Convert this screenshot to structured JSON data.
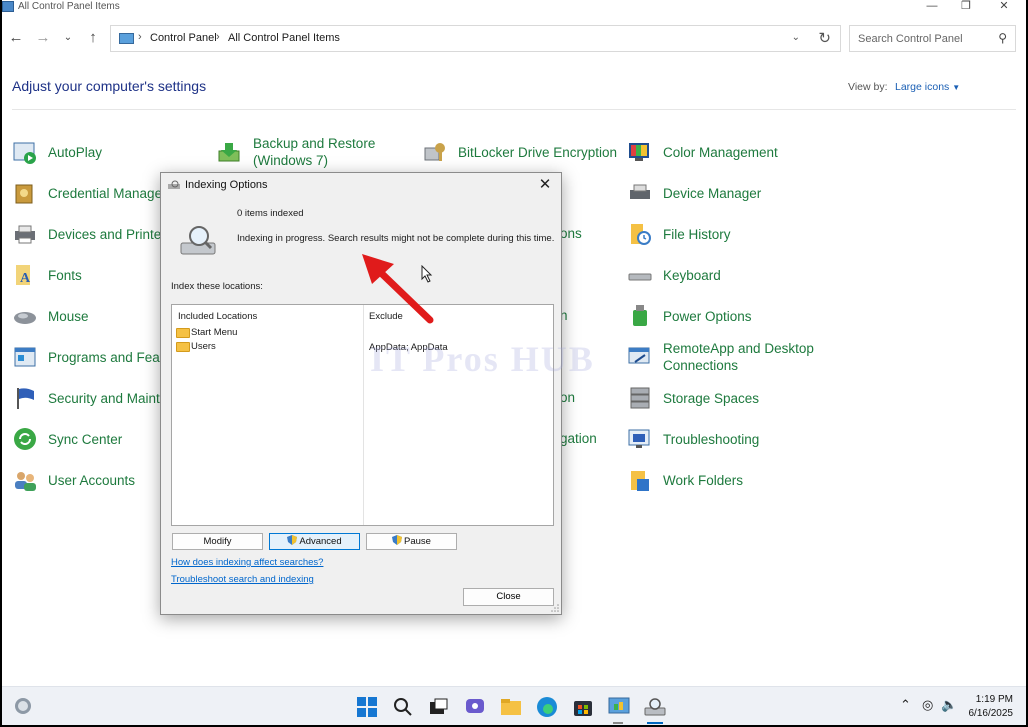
{
  "window": {
    "title": "All Control Panel Items"
  },
  "nav": {
    "breadcrumb": [
      "Control Panel",
      "All Control Panel Items"
    ],
    "search_placeholder": "Search Control Panel"
  },
  "header": {
    "title": "Adjust your computer's settings",
    "view_by_label": "View by:",
    "view_by_value": "Large icons"
  },
  "items": {
    "autoplay": "AutoPlay",
    "backup": "Backup and Restore (Windows 7)",
    "bitlocker": "BitLocker Drive Encryption",
    "color": "Color Management",
    "credential": "Credential Manager",
    "devmgr": "Device Manager",
    "devices": "Devices and Printers",
    "col3_row3_partial": "ons",
    "filehistory": "File History",
    "fonts": "Fonts",
    "keyboard": "Keyboard",
    "mouse": "Mouse",
    "col3_row5_partial": "n",
    "power": "Power Options",
    "programs": "Programs and Featu",
    "remoteapp": "RemoteApp and Desktop Connections",
    "security": "Security and Mainte",
    "col3_row7_partial": "on",
    "storage": "Storage Spaces",
    "sync": "Sync Center",
    "col3_row8_partial": "gation",
    "troubleshooting": "Troubleshooting",
    "users": "User Accounts",
    "workfolders": "Work Folders"
  },
  "dialog": {
    "title": "Indexing Options",
    "count": "0 items indexed",
    "status": "Indexing in progress. Search results might not be complete during this time.",
    "index_label": "Index these locations:",
    "col_included": "Included Locations",
    "col_exclude": "Exclude",
    "locations": [
      "Start Menu",
      "Users"
    ],
    "exclude_value": "AppData; AppData",
    "btn_modify": "Modify",
    "btn_advanced": "Advanced",
    "btn_pause": "Pause",
    "link_affect": "How does indexing affect searches?",
    "link_troubleshoot": "Troubleshoot search and indexing",
    "btn_close": "Close"
  },
  "watermark": "IT Pros HUB",
  "taskbar": {
    "time": "1:19 PM",
    "date": "6/16/2025"
  },
  "colors": {
    "link_green": "#1e7a3e",
    "heading_blue": "#1e3287",
    "accent": "#0078d4",
    "arrow_red": "#e01b1b"
  }
}
